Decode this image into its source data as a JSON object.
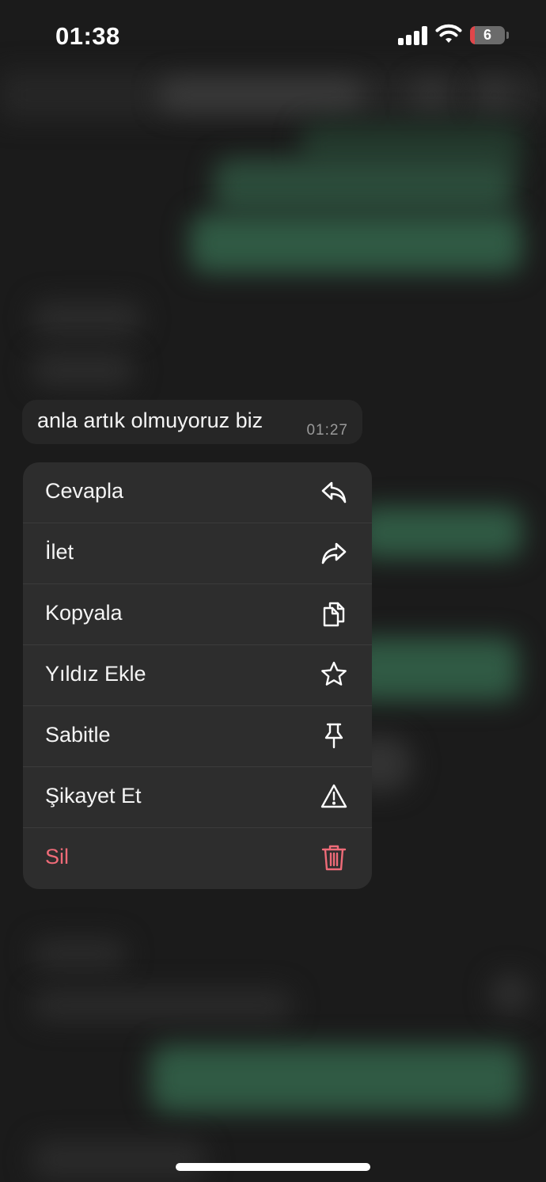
{
  "status_bar": {
    "time": "01:38",
    "battery_level": "6",
    "battery_color": "#e0464a"
  },
  "message": {
    "text": "anla artık olmuyoruz biz",
    "time": "01:27"
  },
  "context_menu": {
    "items": [
      {
        "label": "Cevapla",
        "icon": "reply-icon"
      },
      {
        "label": "İlet",
        "icon": "forward-icon"
      },
      {
        "label": "Kopyala",
        "icon": "copy-icon"
      },
      {
        "label": "Yıldız Ekle",
        "icon": "star-icon"
      },
      {
        "label": "Sabitle",
        "icon": "pin-icon"
      },
      {
        "label": "Şikayet Et",
        "icon": "warning-icon"
      },
      {
        "label": "Sil",
        "icon": "trash-icon",
        "color": "#ef6b78"
      }
    ]
  }
}
